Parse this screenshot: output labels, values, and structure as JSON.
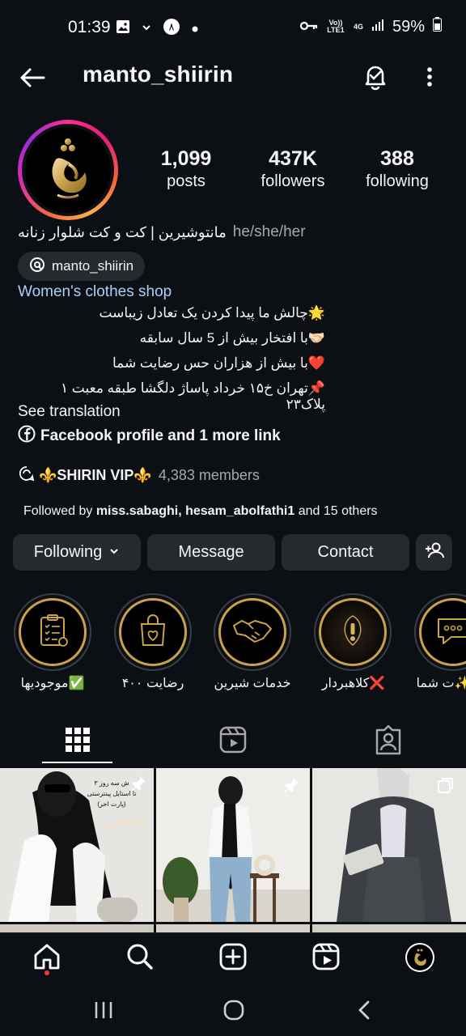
{
  "status_bar": {
    "time": "01:39",
    "battery": "59%",
    "network": "4G",
    "volte": "Vo)) LTE1",
    "icons": [
      "gallery-icon",
      "chevron-icon",
      "vpn-icon",
      "dot-icon",
      "key-icon",
      "signal-icon",
      "battery-icon"
    ]
  },
  "header": {
    "username": "manto_shiirin",
    "icons": [
      "back-arrow-icon",
      "bell-icon",
      "more-icon"
    ]
  },
  "profile": {
    "stats": [
      {
        "value": "1,099",
        "label": "posts"
      },
      {
        "value": "437K",
        "label": "followers"
      },
      {
        "value": "388",
        "label": "following"
      }
    ],
    "display_name": "مانتوشیرین | کت و کت شلوار زنانه",
    "pronouns": "he/she/her",
    "threads_handle": "manto_shiirin",
    "category": "Women's clothes shop",
    "bio_lines": [
      "🌟چالش ما پیدا کردن یک تعادل زیباست",
      "🤝🏻با افتخار بیش از 5 سال سابقه",
      "❤️با بیش از هزاران حس رضایت شما",
      "📌تهران خ۱۵ خرداد پاساژ دلگشا طبقه معبت ۱ پلاک۲۳"
    ],
    "see_translation": "See translation",
    "links_text": "Facebook profile and 1 more link",
    "channel": {
      "name": "⚜️SHIRIN VIP⚜️",
      "members": "4,383 members"
    },
    "followed_by": {
      "prefix": "Followed by ",
      "names": "miss.sabaghi, hesam_abolfathi1",
      "suffix": " and 15 others"
    }
  },
  "actions": {
    "following": "Following",
    "message": "Message",
    "contact": "Contact"
  },
  "highlights": [
    {
      "label": "موجودیها✅"
    },
    {
      "label": "رضایت ۴۰۰"
    },
    {
      "label": "خدمات شیرین"
    },
    {
      "label": "کلاهبردار❌"
    },
    {
      "label": "ت شما✨"
    }
  ],
  "tabs": [
    "grid-icon",
    "reels-icon",
    "tagged-icon"
  ],
  "posts": [
    {
      "caption_lines": [
        "ش سه روز ۳",
        "تا استایل پینترستی",
        "(پارت اخر)"
      ]
    },
    {
      "caption_lines": []
    },
    {
      "caption_lines": []
    }
  ],
  "bottom_nav": [
    "home-icon",
    "search-icon",
    "create-icon",
    "reels-icon",
    "profile-icon"
  ]
}
